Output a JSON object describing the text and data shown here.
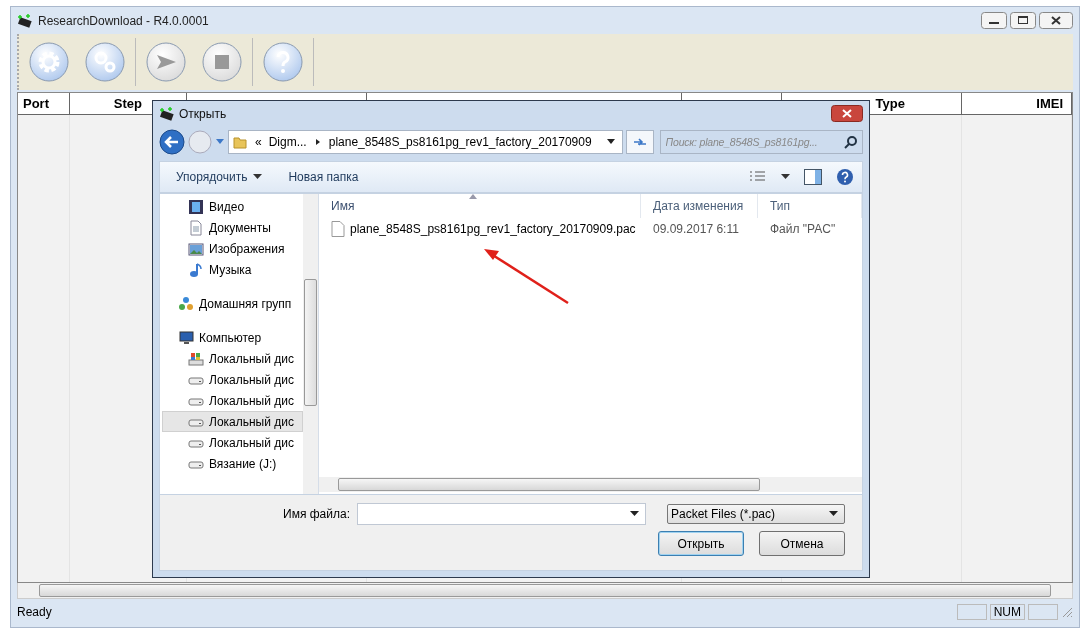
{
  "app": {
    "title": "ResearchDownload - R4.0.0001"
  },
  "toolbar": [
    {
      "kind": "settings",
      "separator_after": false
    },
    {
      "kind": "gears",
      "separator_after": true
    },
    {
      "kind": "start",
      "separator_after": false
    },
    {
      "kind": "stop",
      "separator_after": true
    },
    {
      "kind": "help",
      "separator_after": true
    }
  ],
  "grid": {
    "columns": [
      "Port",
      "Step",
      "Type",
      "IMEI"
    ]
  },
  "status_bar": {
    "text": "Ready",
    "indicators": [
      "NUM"
    ]
  },
  "dialog": {
    "title": "Открыть",
    "address": {
      "crumbs": [
        "«",
        "Digm...",
        "plane_8548S_ps8161pg_rev1_factory_20170909"
      ]
    },
    "search": {
      "placeholder": "Поиск: plane_8548S_ps8161pg..."
    },
    "commands": [
      {
        "label": "Упорядочить",
        "dropdown": true
      },
      {
        "label": "Новая папка",
        "dropdown": false
      }
    ],
    "nav": {
      "sections": [
        {
          "items": [
            {
              "label": "Видео",
              "kind": "video",
              "selected": false
            },
            {
              "label": "Документы",
              "kind": "documents",
              "selected": false
            },
            {
              "label": "Изображения",
              "kind": "pictures",
              "selected": false
            },
            {
              "label": "Музыка",
              "kind": "music",
              "selected": false
            }
          ]
        },
        {
          "items": [
            {
              "label": "Домашняя групп",
              "kind": "homegroup",
              "selected": false
            }
          ]
        },
        {
          "items": [
            {
              "label": "Компьютер",
              "kind": "computer",
              "selected": false,
              "children": [
                {
                  "label": "Локальный дис",
                  "kind": "system-drive",
                  "selected": false
                },
                {
                  "label": "Локальный дис",
                  "kind": "drive",
                  "selected": false
                },
                {
                  "label": "Локальный дис",
                  "kind": "drive",
                  "selected": false
                },
                {
                  "label": "Локальный дис",
                  "kind": "drive",
                  "selected": true
                },
                {
                  "label": "Локальный дис",
                  "kind": "drive",
                  "selected": false
                },
                {
                  "label": "Вязание (J:)",
                  "kind": "drive",
                  "selected": false
                }
              ]
            }
          ]
        }
      ]
    },
    "files": {
      "columns": [
        {
          "label": "Имя",
          "sorted": true
        },
        {
          "label": "Дата изменения",
          "sorted": false
        },
        {
          "label": "Тип",
          "sorted": false
        }
      ],
      "rows": [
        {
          "name": "plane_8548S_ps8161pg_rev1_factory_20170909.pac",
          "date": "09.09.2017 6:11",
          "type": "Файл \"PAC\"",
          "selected": false
        }
      ]
    },
    "filename": {
      "label": "Имя файла:"
    },
    "filter": {
      "value": "Packet Files (*.pac)"
    },
    "buttons": [
      {
        "label": "Открыть",
        "default": true
      },
      {
        "label": "Отмена",
        "default": false
      }
    ]
  }
}
